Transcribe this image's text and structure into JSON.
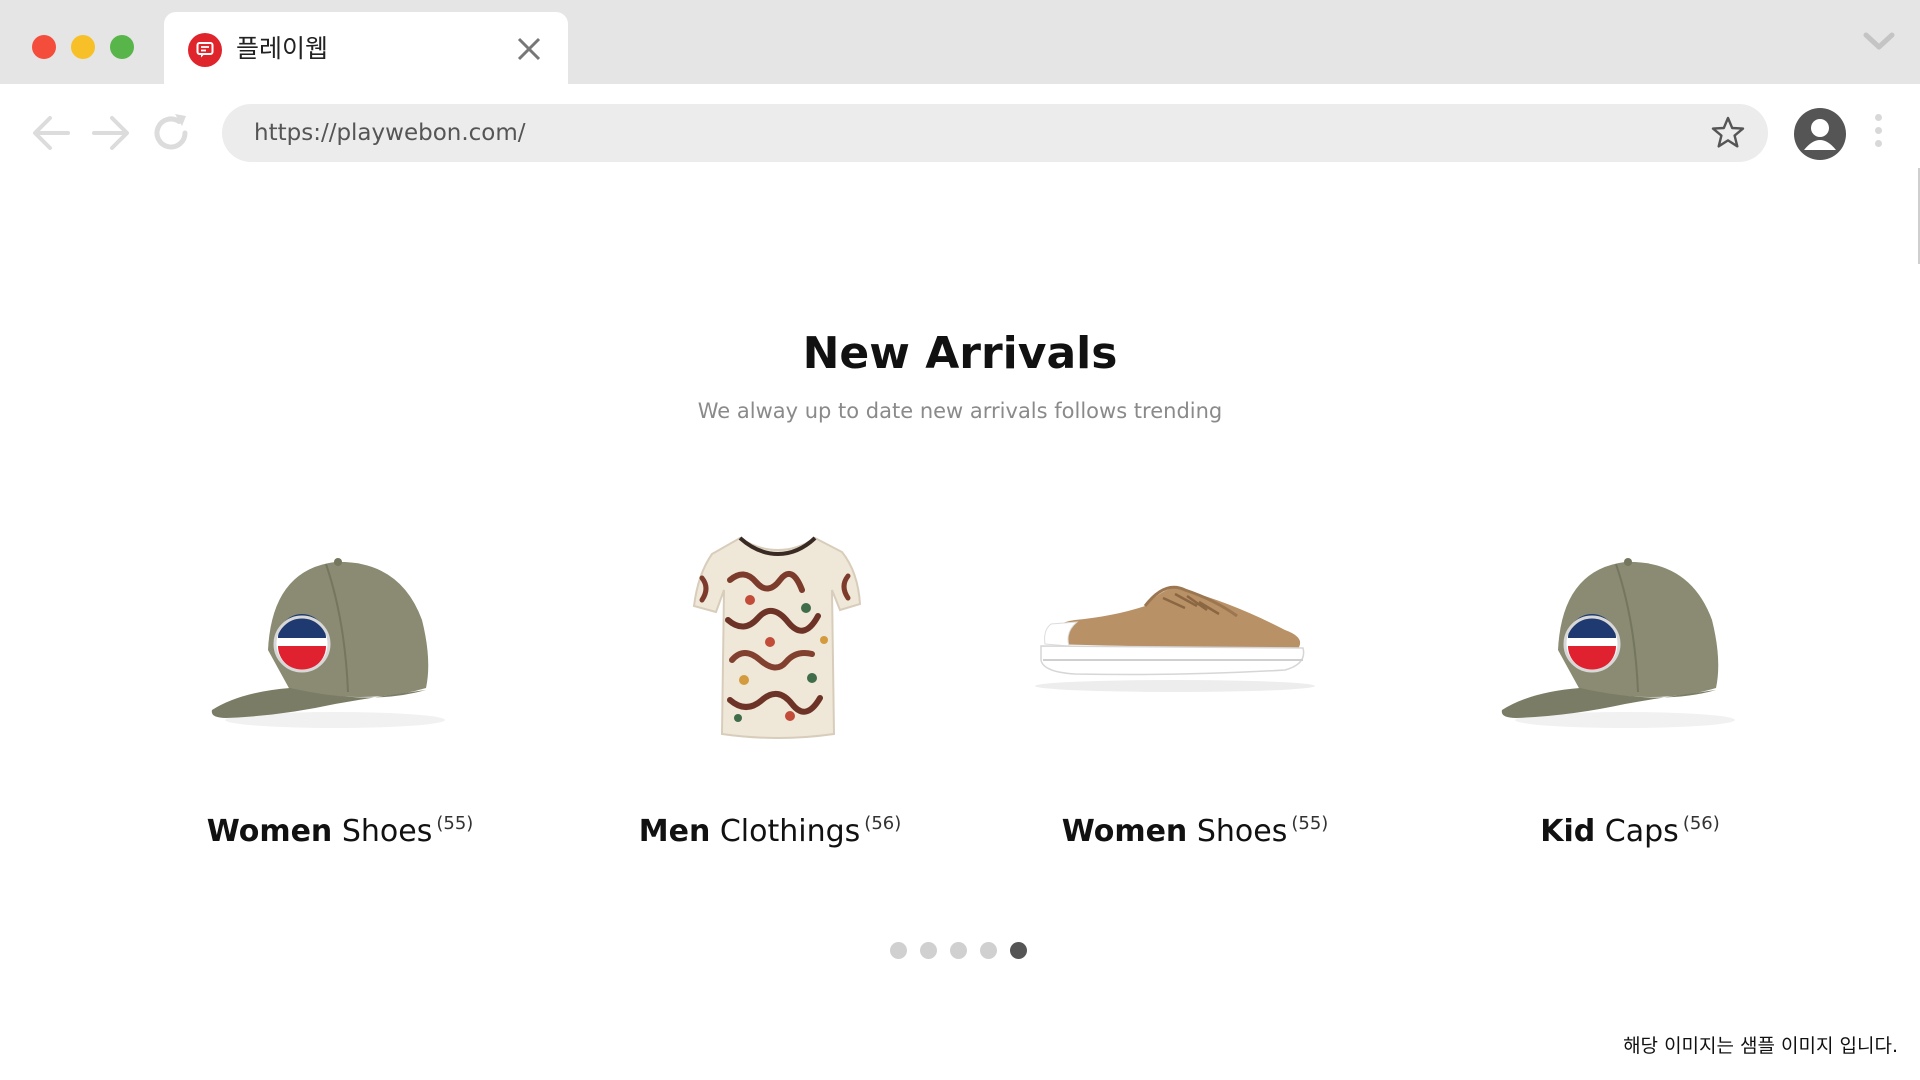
{
  "browser": {
    "tab_title": "플레이웹",
    "url": "https://playwebon.com/",
    "icons": {
      "favicon": "chat-bubble-icon",
      "tab_close": "close-icon",
      "tab_overflow": "chevron-down-icon",
      "back": "arrow-left-icon",
      "forward": "arrow-right-icon",
      "reload": "reload-icon",
      "bookmark": "star-icon",
      "profile": "user-icon",
      "menu": "kebab-icon"
    },
    "colors": {
      "close_dot": "#f44d3b",
      "minimize_dot": "#f8c028",
      "maximize_dot": "#58b549",
      "favicon_red": "#e0242c"
    }
  },
  "section": {
    "title_bold": "New",
    "title_regular": "Arrivals",
    "subtitle": "We alway up to date new arrivals follows trending"
  },
  "products": [
    {
      "bold": "Women",
      "regular": "Shoes",
      "count": "(55)",
      "image": "cap"
    },
    {
      "bold": "Men",
      "regular": "Clothings",
      "count": "(56)",
      "image": "t-shirt"
    },
    {
      "bold": "Women",
      "regular": "Shoes",
      "count": "(55)",
      "image": "sneaker"
    },
    {
      "bold": "Kid",
      "regular": "Caps",
      "count": "(56)",
      "image": "cap"
    }
  ],
  "carousel": {
    "total_pages": 5,
    "active_page": 5
  },
  "notice": "해당 이미지는 샘플 이미지 입니다."
}
